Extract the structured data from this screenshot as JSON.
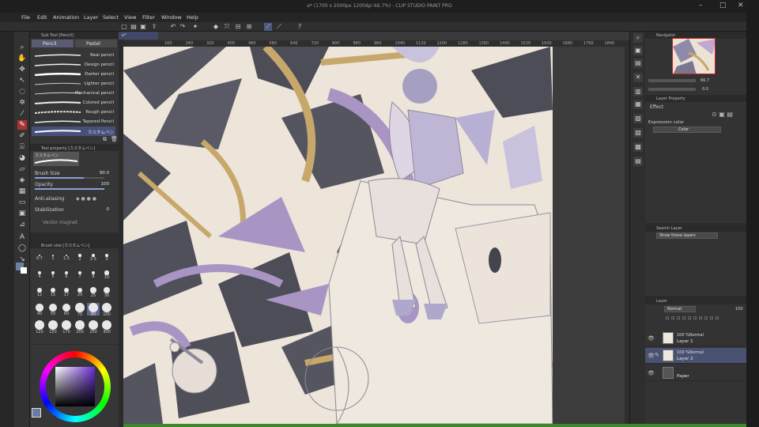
{
  "window": {
    "title": "e* (1700 x 2000px 1200dpi 66.7%) - CLIP STUDIO PAINT PRO",
    "controls": [
      "–",
      "□",
      "✕"
    ]
  },
  "menu": [
    "File",
    "Edit",
    "Animation",
    "Layer",
    "Select",
    "View",
    "Filter",
    "Window",
    "Help"
  ],
  "sub_tool": {
    "panel_title": "Sub Tool [Pencil]",
    "tabs": [
      "Pencil",
      "Pastel"
    ],
    "brushes": [
      "Real pencil",
      "Design pencil",
      "Darker pencil",
      "Lighter pencil",
      "Mechanical pencil",
      "Colored pencil",
      "Rough pencil",
      "Tapered Pencil",
      "カスタムペン"
    ]
  },
  "tool_property": {
    "panel_title": "Tool property [カスタムペン]",
    "brush_name": "カスタムペン",
    "brush_size_label": "Brush Size",
    "brush_size_value": "90.0",
    "opacity_label": "Opacity",
    "opacity_value": "100",
    "anti_aliasing_label": "Anti-aliasing",
    "stabilization_label": "Stabilization",
    "stabilization_value": "0",
    "vector_magnet_label": "Vector magnet"
  },
  "brush_size": {
    "panel_title": "Brush size [カスタムペン]",
    "sizes": [
      "0.7",
      "1",
      "1.5",
      "2",
      "2.5",
      "3",
      "4",
      "5",
      "6",
      "7",
      "8",
      "10",
      "12",
      "15",
      "17",
      "20",
      "25",
      "30",
      "40",
      "50",
      "60",
      "70",
      "80",
      "100",
      "120",
      "150",
      "170",
      "200",
      "250",
      "300"
    ],
    "selected": "80"
  },
  "canvas": {
    "ruler_ticks": [
      "160",
      "240",
      "320",
      "400",
      "480",
      "560",
      "640",
      "720",
      "800",
      "880",
      "960",
      "1040",
      "1120",
      "1200",
      "1280",
      "1360",
      "1440",
      "1520",
      "1600",
      "1680",
      "1760",
      "1840"
    ],
    "document_tab": "e*"
  },
  "navigator": {
    "panel_title": "Navigator",
    "zoom": "66.7",
    "rotate": "0.0"
  },
  "layer_property": {
    "panel_title": "Layer Property",
    "effect_label": "Effect",
    "expression_color_label": "Expression color",
    "expression_color_value": "Color"
  },
  "search_layer": {
    "panel_title": "Search Layer",
    "filter_value": "Show these layers"
  },
  "layer": {
    "panel_title": "Layer",
    "blend_mode": "Normal",
    "opacity": "100",
    "layers": [
      {
        "meta": "100 %Normal",
        "name": "Layer 1",
        "selected": false
      },
      {
        "meta": "100 %Normal",
        "name": "Layer 2",
        "selected": true
      },
      {
        "meta": "",
        "name": "Paper",
        "selected": false
      }
    ]
  }
}
